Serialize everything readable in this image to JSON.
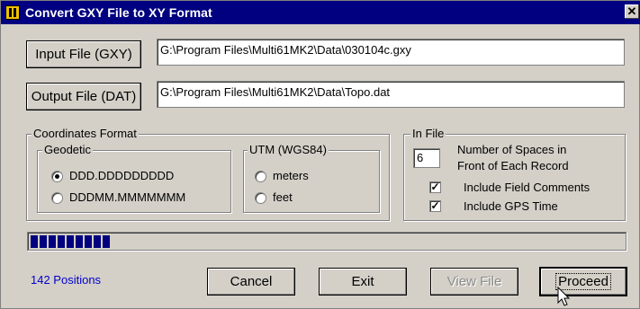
{
  "window": {
    "title": "Convert GXY File to XY Format",
    "close_glyph": "✕"
  },
  "input": {
    "button_label": "Input File (GXY)",
    "path": "G:\\Program Files\\Multi61MK2\\Data\\030104c.gxy"
  },
  "output": {
    "button_label": "Output File (DAT)",
    "path": "G:\\Program Files\\Multi61MK2\\Data\\Topo.dat"
  },
  "coordinates": {
    "legend": "Coordinates Format",
    "geodetic": {
      "legend": "Geodetic",
      "options": [
        "DDD.DDDDDDDDD",
        "DDDMM.MMMMMMM"
      ],
      "selected": 0
    },
    "utm": {
      "legend": "UTM (WGS84)",
      "options": [
        "meters",
        "feet"
      ]
    }
  },
  "in_file": {
    "legend": "In File",
    "spaces_value": "6",
    "spaces_label_line1": "Number of Spaces in",
    "spaces_label_line2": "Front of Each Record",
    "include_comments": "Include Field Comments",
    "include_gps_time": "Include GPS Time",
    "check_glyph": "✓"
  },
  "progress": {
    "fraction": 0.16,
    "blocks": 9
  },
  "status": {
    "positions": "142 Positions"
  },
  "buttons": {
    "cancel": "Cancel",
    "exit": "Exit",
    "view_file": "View File",
    "proceed": "Proceed"
  },
  "colors": {
    "title_bar": "#000080",
    "progress": "#000080",
    "status_text": "#0000cc"
  }
}
